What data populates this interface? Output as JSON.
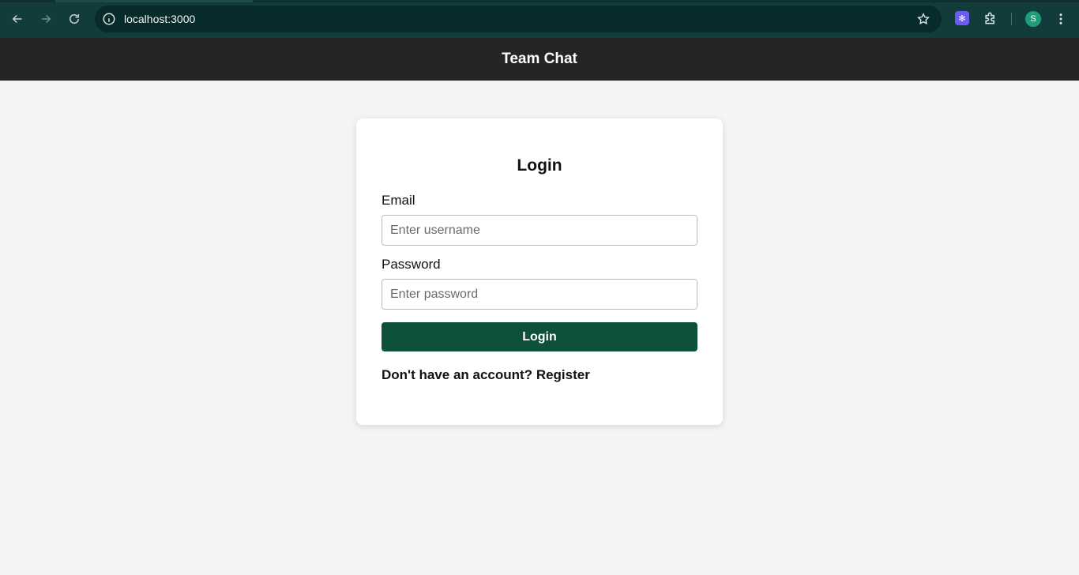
{
  "browser": {
    "url": "localhost:3000",
    "profile_initial": "S",
    "colors": {
      "frame": "#123b3c",
      "omnibox": "#072a2b",
      "extension": "#6a5cf3",
      "avatar": "#1f9e7a"
    },
    "icons": [
      "back-arrow-icon",
      "forward-arrow-icon",
      "reload-icon",
      "info-icon",
      "star-icon",
      "extension-icon",
      "puzzle-icon",
      "kebab-menu-icon"
    ]
  },
  "header": {
    "title": "Team Chat",
    "background": "#252525"
  },
  "login": {
    "title": "Login",
    "email_label": "Email",
    "email_placeholder": "Enter username",
    "password_label": "Password",
    "password_placeholder": "Enter password",
    "submit_label": "Login",
    "register_prompt": "Don't have an account?",
    "register_link": "Register",
    "button_color": "#0c5138"
  }
}
